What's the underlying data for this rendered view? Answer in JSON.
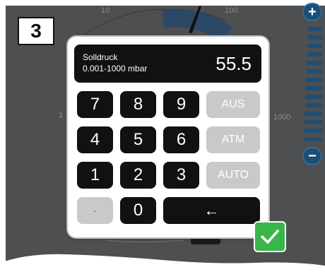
{
  "step_number": "3",
  "gauge": {
    "scale_labels": [
      "10",
      "100",
      "1",
      "1000"
    ]
  },
  "side_slider": {
    "plus_label": "+",
    "minus_label": "−"
  },
  "keypad_dialog": {
    "field_label": "Solldruck",
    "range_label": "0.001-1000 mbar",
    "value": "55.5",
    "keys": {
      "k7": "7",
      "k8": "8",
      "k9": "9",
      "k4": "4",
      "k5": "5",
      "k6": "6",
      "k1": "1",
      "k2": "2",
      "k3": "3",
      "dot": "·",
      "k0": "0",
      "backspace": "←"
    },
    "mode_buttons": {
      "aus": "AUS",
      "atm": "ATM",
      "auto": "AUTO"
    }
  },
  "confirm_icon": "checkmark-icon",
  "colors": {
    "panel_background": "#4d4f51",
    "key_dark": "#111111",
    "key_light": "#c9c9c9",
    "confirm_green": "#3ab54a",
    "slider_blue": "#1d4f75"
  }
}
